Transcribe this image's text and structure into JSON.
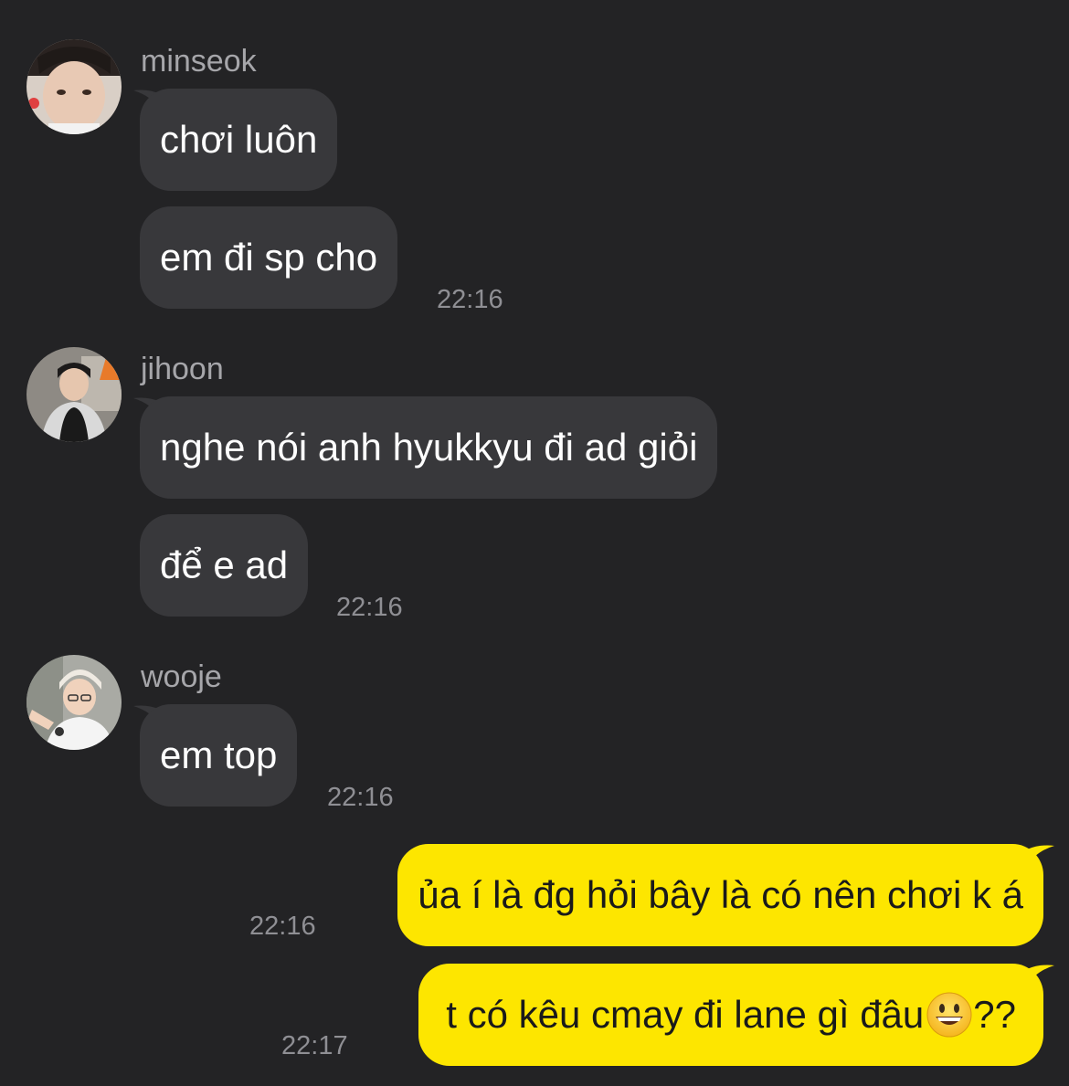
{
  "messages": [
    {
      "sender": "minseok",
      "avatar": "minseok-avatar",
      "bubbles": [
        "chơi luôn",
        "em đi sp cho"
      ],
      "time": "22:16"
    },
    {
      "sender": "jihoon",
      "avatar": "jihoon-avatar",
      "bubbles": [
        "nghe nói anh hyukkyu đi ad giỏi",
        "để e ad"
      ],
      "time": "22:16"
    },
    {
      "sender": "wooje",
      "avatar": "wooje-avatar",
      "bubbles": [
        "em top"
      ],
      "time": "22:16"
    }
  ],
  "outgoing": [
    {
      "text": "ủa í là đg hỏi bây là có nên chơi k á",
      "time": "22:16"
    },
    {
      "text": "t có kêu cmay đi lane gì đâu",
      "emoji": "grinning-face-emoji",
      "suffix": "??",
      "time": "22:17"
    }
  ],
  "colors": {
    "background": "#232325",
    "incoming_bubble": "#38383b",
    "outgoing_bubble": "#fde600",
    "timestamp": "#8f8f94",
    "sender_name": "#a6a6aa"
  }
}
